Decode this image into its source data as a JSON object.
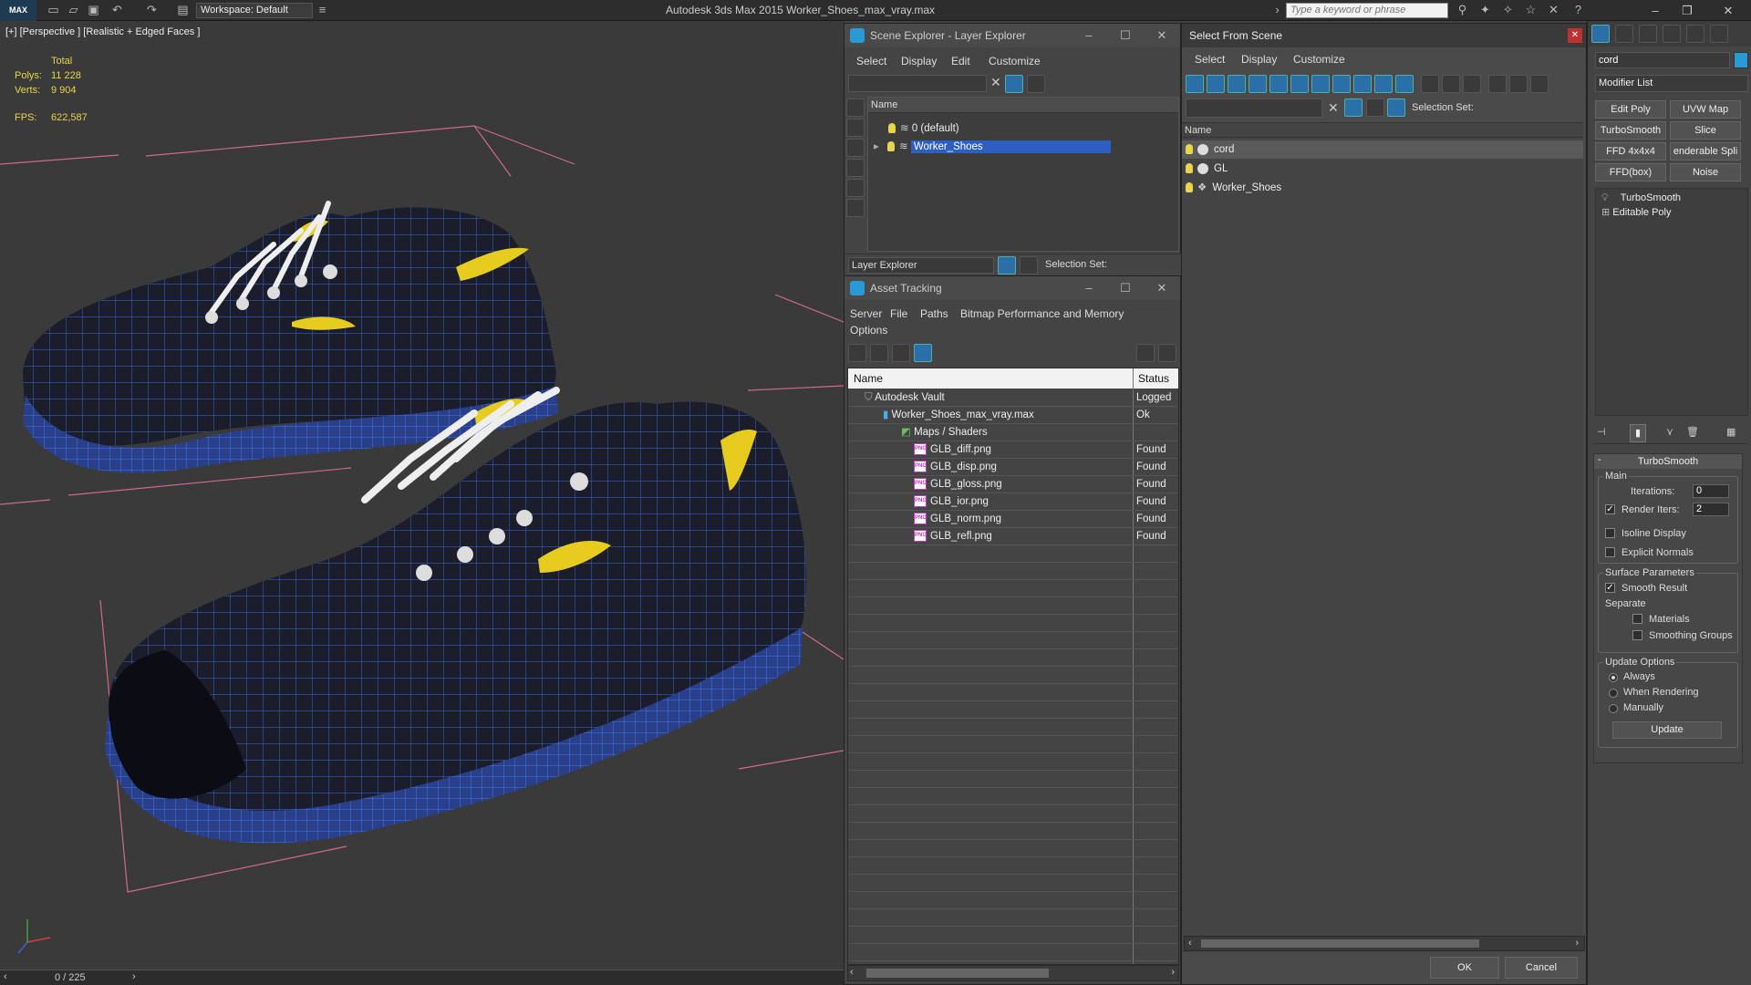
{
  "titlebar": {
    "logo": "MAX",
    "workspace": "Workspace: Default",
    "app_title": "Autodesk 3ds Max  2015     Worker_Shoes_max_vray.max",
    "search_placeholder": "Type a keyword or phrase"
  },
  "viewport": {
    "label": "[+] [Perspective ] [Realistic + Edged Faces ]",
    "stats": {
      "total_label": "Total",
      "polys_label": "Polys:",
      "polys_value": "11 228",
      "verts_label": "Verts:",
      "verts_value": "9 904",
      "fps_label": "FPS:",
      "fps_value": "622,587"
    },
    "timeline_label": "0 / 225"
  },
  "scene_explorer": {
    "title": "Scene Explorer - Layer Explorer",
    "menu": [
      "Select",
      "Display",
      "Edit",
      "Customize"
    ],
    "column_name": "Name",
    "rows": [
      "0 (default)",
      "Worker_Shoes"
    ],
    "footer_dropdown": "Layer Explorer",
    "selection_set_label": "Selection Set:"
  },
  "asset_tracking": {
    "title": "Asset Tracking",
    "menu": [
      "Server",
      "File",
      "Paths",
      "Bitmap Performance and Memory",
      "Options"
    ],
    "col_name": "Name",
    "col_status": "Status",
    "rows": [
      {
        "name": "Autodesk Vault",
        "status": "Logged"
      },
      {
        "name": "Worker_Shoes_max_vray.max",
        "status": "Ok"
      },
      {
        "name": "Maps / Shaders",
        "status": ""
      },
      {
        "name": "GLB_diff.png",
        "status": "Found"
      },
      {
        "name": "GLB_disp.png",
        "status": "Found"
      },
      {
        "name": "GLB_gloss.png",
        "status": "Found"
      },
      {
        "name": "GLB_ior.png",
        "status": "Found"
      },
      {
        "name": "GLB_norm.png",
        "status": "Found"
      },
      {
        "name": "GLB_refl.png",
        "status": "Found"
      }
    ]
  },
  "select_from_scene": {
    "title": "Select From Scene",
    "menu": [
      "Select",
      "Display",
      "Customize"
    ],
    "selection_set_label": "Selection Set:",
    "column_name": "Name",
    "rows": [
      "cord",
      "GL",
      "Worker_Shoes"
    ],
    "ok": "OK",
    "cancel": "Cancel"
  },
  "command_panel": {
    "object_name": "cord",
    "modifier_list": "Modifier List",
    "buttons": [
      "Edit Poly",
      "UVW Map",
      "TurboSmooth",
      "Slice",
      "FFD 4x4x4",
      "enderable Spli",
      "FFD(box)",
      "Noise"
    ],
    "stack": [
      "TurboSmooth",
      "Editable Poly"
    ],
    "rollout_title": "TurboSmooth",
    "main_label": "Main",
    "iterations_label": "Iterations:",
    "iterations_value": "0",
    "render_iters_label": "Render Iters:",
    "render_iters_value": "2",
    "isoline_label": "Isoline Display",
    "explicit_normals_label": "Explicit Normals",
    "surface_params_label": "Surface Parameters",
    "smooth_result_label": "Smooth Result",
    "separate_label": "Separate",
    "materials_label": "Materials",
    "smoothing_groups_label": "Smoothing Groups",
    "update_options_label": "Update Options",
    "always_label": "Always",
    "when_rendering_label": "When Rendering",
    "manually_label": "Manually",
    "update_button": "Update"
  }
}
